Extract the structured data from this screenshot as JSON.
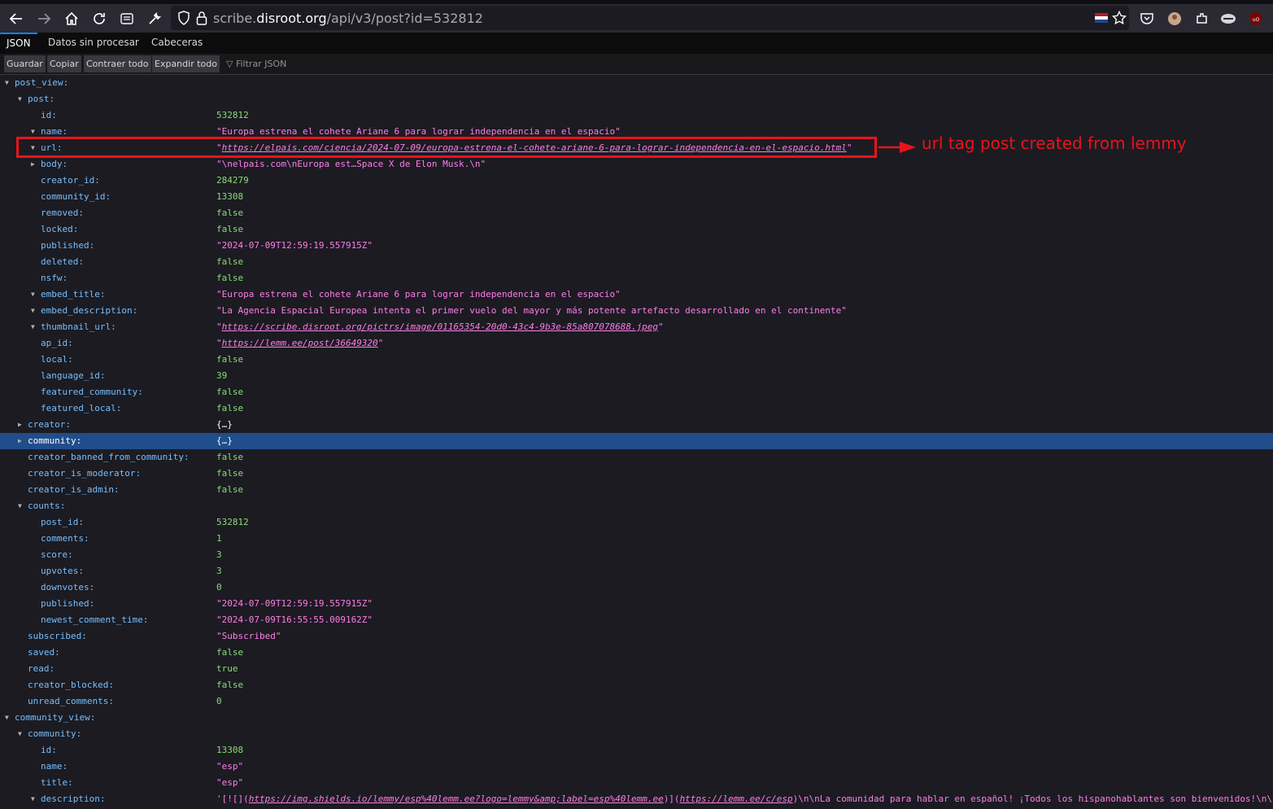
{
  "browser": {
    "url_prefix": "scribe.",
    "url_host": "disroot.org",
    "url_path": "/api/v3/post?id=532812"
  },
  "viewer": {
    "tabs": [
      "JSON",
      "Datos sin procesar",
      "Cabeceras"
    ],
    "buttons": [
      "Guardar",
      "Copiar",
      "Contraer todo",
      "Expandir todo"
    ],
    "filter_placeholder": "Filtrar JSON"
  },
  "tree": [
    {
      "key": "post_view:",
      "depth": 0,
      "tw": "open",
      "val": "",
      "vt": ""
    },
    {
      "key": "post:",
      "depth": 1,
      "tw": "open",
      "val": "",
      "vt": ""
    },
    {
      "key": "id:",
      "depth": 2,
      "tw": "",
      "val": "532812",
      "vt": "num"
    },
    {
      "key": "name:",
      "depth": 2,
      "tw": "open",
      "val": "\"Europa estrena el cohete Ariane 6 para lograr independencia en el espacio\"",
      "vt": "str"
    },
    {
      "key": "url:",
      "depth": 2,
      "tw": "open",
      "val": "https://elpais.com/ciencia/2024-07-09/europa-estrena-el-cohete-ariane-6-para-lograr-independencia-en-el-espacio.html",
      "vt": "link"
    },
    {
      "key": "body:",
      "depth": 2,
      "tw": "closed",
      "val": "\"\\nelpais.com\\nEuropa est…Space X de Elon Musk.\\n\"",
      "vt": "str"
    },
    {
      "key": "creator_id:",
      "depth": 2,
      "tw": "",
      "val": "284279",
      "vt": "num"
    },
    {
      "key": "community_id:",
      "depth": 2,
      "tw": "",
      "val": "13308",
      "vt": "num"
    },
    {
      "key": "removed:",
      "depth": 2,
      "tw": "",
      "val": "false",
      "vt": "bool"
    },
    {
      "key": "locked:",
      "depth": 2,
      "tw": "",
      "val": "false",
      "vt": "bool"
    },
    {
      "key": "published:",
      "depth": 2,
      "tw": "",
      "val": "\"2024-07-09T12:59:19.557915Z\"",
      "vt": "str"
    },
    {
      "key": "deleted:",
      "depth": 2,
      "tw": "",
      "val": "false",
      "vt": "bool"
    },
    {
      "key": "nsfw:",
      "depth": 2,
      "tw": "",
      "val": "false",
      "vt": "bool"
    },
    {
      "key": "embed_title:",
      "depth": 2,
      "tw": "open",
      "val": "\"Europa estrena el cohete Ariane 6 para lograr independencia en el espacio\"",
      "vt": "str"
    },
    {
      "key": "embed_description:",
      "depth": 2,
      "tw": "open",
      "val": "\"La Agencia Espacial Europea intenta  el primer vuelo del mayor y más potente artefacto desarrollado en el continente\"",
      "vt": "str"
    },
    {
      "key": "thumbnail_url:",
      "depth": 2,
      "tw": "open",
      "val": "https://scribe.disroot.org/pictrs/image/01165354-20d0-43c4-9b3e-85a807078688.jpeg",
      "vt": "link"
    },
    {
      "key": "ap_id:",
      "depth": 2,
      "tw": "",
      "val": "https://lemm.ee/post/36649320",
      "vt": "link"
    },
    {
      "key": "local:",
      "depth": 2,
      "tw": "",
      "val": "false",
      "vt": "bool"
    },
    {
      "key": "language_id:",
      "depth": 2,
      "tw": "",
      "val": "39",
      "vt": "num"
    },
    {
      "key": "featured_community:",
      "depth": 2,
      "tw": "",
      "val": "false",
      "vt": "bool"
    },
    {
      "key": "featured_local:",
      "depth": 2,
      "tw": "",
      "val": "false",
      "vt": "bool"
    },
    {
      "key": "creator:",
      "depth": 1,
      "tw": "closed",
      "val": "{…}",
      "vt": "obj"
    },
    {
      "key": "community:",
      "depth": 1,
      "tw": "closed",
      "val": "{…}",
      "vt": "obj",
      "selected": true
    },
    {
      "key": "creator_banned_from_community:",
      "depth": 1,
      "tw": "",
      "val": "false",
      "vt": "bool"
    },
    {
      "key": "creator_is_moderator:",
      "depth": 1,
      "tw": "",
      "val": "false",
      "vt": "bool"
    },
    {
      "key": "creator_is_admin:",
      "depth": 1,
      "tw": "",
      "val": "false",
      "vt": "bool"
    },
    {
      "key": "counts:",
      "depth": 1,
      "tw": "open",
      "val": "",
      "vt": ""
    },
    {
      "key": "post_id:",
      "depth": 2,
      "tw": "",
      "val": "532812",
      "vt": "num"
    },
    {
      "key": "comments:",
      "depth": 2,
      "tw": "",
      "val": "1",
      "vt": "num"
    },
    {
      "key": "score:",
      "depth": 2,
      "tw": "",
      "val": "3",
      "vt": "num"
    },
    {
      "key": "upvotes:",
      "depth": 2,
      "tw": "",
      "val": "3",
      "vt": "num"
    },
    {
      "key": "downvotes:",
      "depth": 2,
      "tw": "",
      "val": "0",
      "vt": "num"
    },
    {
      "key": "published:",
      "depth": 2,
      "tw": "",
      "val": "\"2024-07-09T12:59:19.557915Z\"",
      "vt": "str"
    },
    {
      "key": "newest_comment_time:",
      "depth": 2,
      "tw": "",
      "val": "\"2024-07-09T16:55:55.009162Z\"",
      "vt": "str"
    },
    {
      "key": "subscribed:",
      "depth": 1,
      "tw": "",
      "val": "\"Subscribed\"",
      "vt": "str"
    },
    {
      "key": "saved:",
      "depth": 1,
      "tw": "",
      "val": "false",
      "vt": "bool"
    },
    {
      "key": "read:",
      "depth": 1,
      "tw": "",
      "val": "true",
      "vt": "bool"
    },
    {
      "key": "creator_blocked:",
      "depth": 1,
      "tw": "",
      "val": "false",
      "vt": "bool"
    },
    {
      "key": "unread_comments:",
      "depth": 1,
      "tw": "",
      "val": "0",
      "vt": "num"
    },
    {
      "key": "community_view:",
      "depth": 0,
      "tw": "open",
      "val": "",
      "vt": ""
    },
    {
      "key": "community:",
      "depth": 1,
      "tw": "open",
      "val": "",
      "vt": ""
    },
    {
      "key": "id:",
      "depth": 2,
      "tw": "",
      "val": "13308",
      "vt": "num"
    },
    {
      "key": "name:",
      "depth": 2,
      "tw": "",
      "val": "\"esp\"",
      "vt": "str"
    },
    {
      "key": "title:",
      "depth": 2,
      "tw": "",
      "val": "\"esp\"",
      "vt": "str"
    },
    {
      "key": "description:",
      "depth": 2,
      "tw": "open",
      "val": "",
      "vt": "desc"
    }
  ],
  "description_value": {
    "pre": "'[![](",
    "link1": "https://img.shields.io/lemmy/esp%40lemm.ee?logo=lemmy&amp;label=esp%40lemm.ee",
    "mid": ")](",
    "link2": "https://lemm.ee/c/esp",
    "post": ")\\n\\nLa comunidad para hablar en español! ¡Todos los hispanohablantes son bienvenidos!\\n\\"
  },
  "annotation": {
    "text": "url tag post created from lemmy"
  },
  "colors": {
    "key": "#75bfff",
    "string": "#ff7de9",
    "number": "#86de74",
    "selected_row": "#204e8a",
    "annotation": "#e8141b"
  }
}
